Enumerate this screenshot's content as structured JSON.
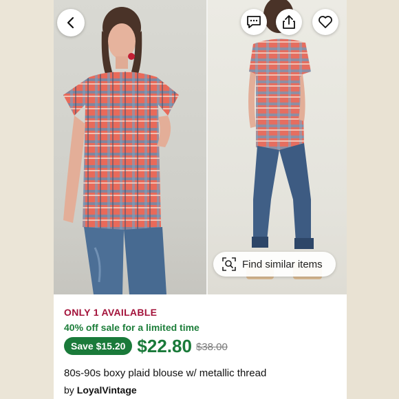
{
  "listing": {
    "availability": "ONLY 1 AVAILABLE",
    "sale_text": "40% off sale for a limited time",
    "save_label": "Save $15.20",
    "price": "$22.80",
    "original_price": "$38.00",
    "title": "80s-90s boxy plaid blouse w/ metallic thread",
    "seller_prefix": "by",
    "seller_name": "LoyalVintage"
  },
  "overlay": {
    "find_similar_label": "Find similar items"
  },
  "icons": {
    "back": "chevron-left-icon",
    "message": "message-icon",
    "share": "share-icon",
    "favorite": "heart-icon",
    "visual_search": "visual-search-icon"
  },
  "colors": {
    "availability": "#a3123a",
    "sale_green": "#1a7a3a",
    "page_background": "#eae4d6"
  }
}
